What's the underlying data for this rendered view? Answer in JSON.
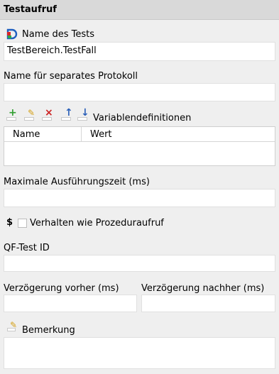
{
  "header": {
    "title": "Testaufruf"
  },
  "test_name": {
    "label": "Name des Tests",
    "value": "TestBereich.TestFall"
  },
  "separate_protocol": {
    "label": "Name für separates Protokoll",
    "value": ""
  },
  "variables": {
    "label": "Variablendefinitionen",
    "toolbar": [
      {
        "name": "add-icon",
        "glyph": "+",
        "color": "#2e9e2e"
      },
      {
        "name": "edit-icon",
        "glyph": "✎",
        "color": "#d4a017"
      },
      {
        "name": "delete-icon",
        "glyph": "×",
        "color": "#cc2222"
      },
      {
        "name": "move-up-icon",
        "glyph": "↑",
        "color": "#2a5fb8"
      },
      {
        "name": "move-down-icon",
        "glyph": "↓",
        "color": "#2a5fb8"
      }
    ],
    "columns": [
      "Name",
      "Wert"
    ]
  },
  "max_time": {
    "label": "Maximale Ausführungszeit (ms)",
    "value": ""
  },
  "procedure_behavior": {
    "dollar": "$",
    "label": "Verhalten wie Prozeduraufruf",
    "checked": false
  },
  "qftest_id": {
    "label": "QF-Test ID",
    "value": ""
  },
  "delay_before": {
    "label": "Verzögerung vorher (ms)",
    "value": ""
  },
  "delay_after": {
    "label": "Verzögerung nachher (ms)",
    "value": ""
  },
  "comment": {
    "label": "Bemerkung",
    "value": ""
  }
}
